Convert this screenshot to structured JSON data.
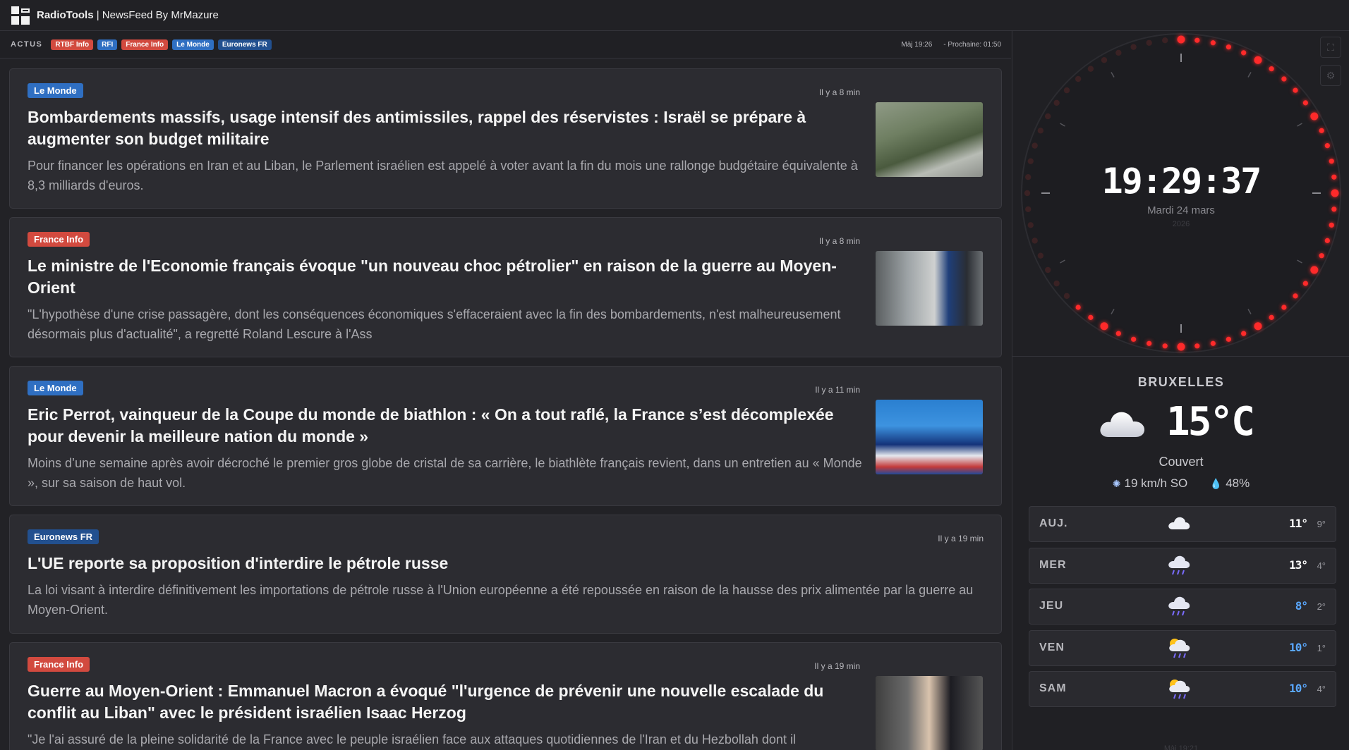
{
  "app": {
    "title_bold": "RadioTools",
    "title_rest": " | NewsFeed By MrMazure"
  },
  "newsbar": {
    "label": "ACTUS",
    "sources": [
      {
        "label": "RTBF Info",
        "color": "#d24a3f"
      },
      {
        "label": "RFI",
        "color": "#2f6fc2"
      },
      {
        "label": "France Info",
        "color": "#d24a3f"
      },
      {
        "label": "Le Monde",
        "color": "#2f6fc2"
      },
      {
        "label": "Euronews FR",
        "color": "#22508f"
      }
    ],
    "updated": "Màj 19:26",
    "next": "- Prochaine: 01:50"
  },
  "articles": [
    {
      "source": "Le Monde",
      "source_color": "#2f6fc2",
      "age": "Il y a 8 min",
      "title": "Bombardements massifs, usage intensif des antimissiles, rappel des réservistes : Israël se prépare à augmenter son budget militaire",
      "desc": "Pour financer les opérations en Iran et au Liban, le Parlement israélien est appelé à voter avant la fin du mois une rallonge budgétaire équivalente à 8,3 milliards d'euros."
    },
    {
      "source": "France Info",
      "source_color": "#d24a3f",
      "age": "Il y a 8 min",
      "title": "Le ministre de l'Economie français évoque \"un nouveau choc pétrolier\" en raison de la guerre au Moyen-Orient",
      "desc": "\"L'hypothèse d'une crise passagère, dont les conséquences économiques s'effaceraient avec la fin des bombardements, n'est malheureusement désormais plus d'actualité\", a regretté Roland Lescure à l'Ass"
    },
    {
      "source": "Le Monde",
      "source_color": "#2f6fc2",
      "age": "Il y a 11 min",
      "title": "Eric Perrot, vainqueur de la Coupe du monde de biathlon : « On a tout raflé, la France s’est décomplexée pour devenir la meilleure nation du monde »",
      "desc": "Moins d’une semaine après avoir décroché le premier gros globe de cristal de sa carrière, le biathlète français revient, dans un entretien au « Monde », sur sa saison de haut vol."
    },
    {
      "source": "Euronews FR",
      "source_color": "#22508f",
      "age": "Il y a 19 min",
      "title": "L'UE reporte sa proposition d'interdire le pétrole russe",
      "desc": "La loi visant à interdire définitivement les importations de pétrole russe à l'Union européenne a été repoussée en raison de la hausse des prix alimentée par la guerre au Moyen-Orient."
    },
    {
      "source": "France Info",
      "source_color": "#d24a3f",
      "age": "Il y a 19 min",
      "title": "Guerre au Moyen-Orient : Emmanuel Macron a évoqué \"l'urgence de prévenir une nouvelle escalade du conflit au Liban\" avec le président israélien Isaac Herzog",
      "desc": "\"Je l'ai assuré de la pleine solidarité de la France avec le peuple israélien face aux attaques quotidiennes de l'Iran et du Hezbollah dont il"
    }
  ],
  "clock": {
    "time": "19:29:37",
    "date": "Mardi 24 mars",
    "year": "2026",
    "seconds": 37,
    "accent": "#ff2a2a"
  },
  "weather": {
    "city": "BRUXELLES",
    "temp": "15°C",
    "condition": "Couvert",
    "wind": "19 km/h SO",
    "humidity": "48%",
    "forecast": [
      {
        "day": "AUJ.",
        "hi": "11°",
        "lo": "9°",
        "icon": "cloud-icon",
        "hi_color": "#ffffff"
      },
      {
        "day": "MER",
        "hi": "13°",
        "lo": "4°",
        "icon": "rain-cloud-icon",
        "hi_color": "#ffffff"
      },
      {
        "day": "JEU",
        "hi": "8°",
        "lo": "2°",
        "icon": "rain-cloud-icon",
        "hi_color": "#5aa8ff"
      },
      {
        "day": "VEN",
        "hi": "10°",
        "lo": "1°",
        "icon": "sun-rain-cloud-icon",
        "hi_color": "#5aa8ff"
      },
      {
        "day": "SAM",
        "hi": "10°",
        "lo": "4°",
        "icon": "sun-rain-cloud-icon",
        "hi_color": "#5aa8ff"
      }
    ],
    "updated": "Màj 19:21"
  }
}
